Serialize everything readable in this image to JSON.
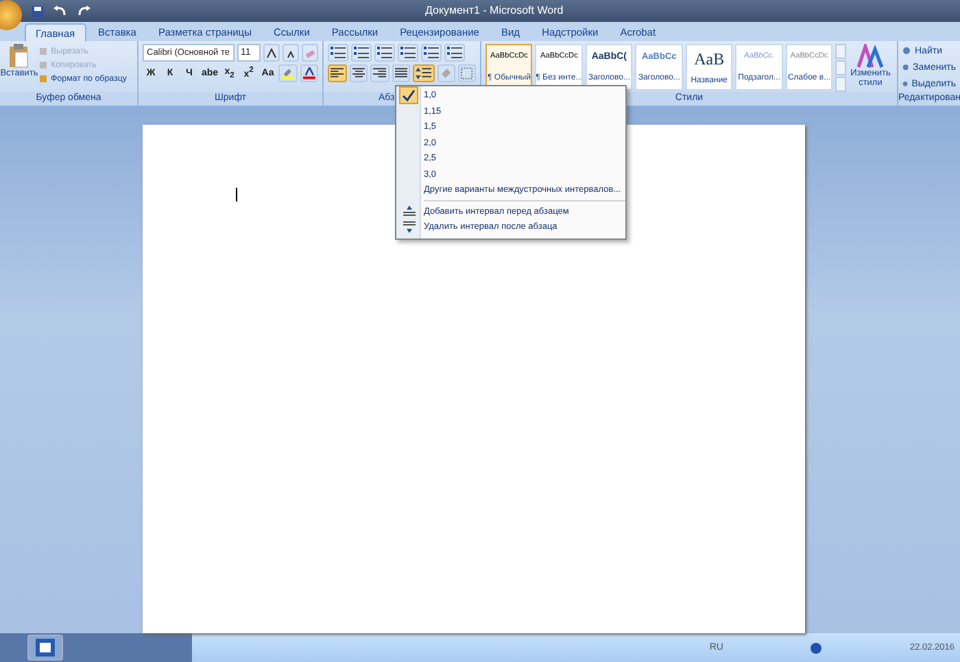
{
  "window": {
    "title": "Документ1 - Microsoft Word"
  },
  "tabs": [
    {
      "label": "Главная",
      "selected": true
    },
    {
      "label": "Вставка",
      "selected": false
    },
    {
      "label": "Разметка страницы",
      "selected": false
    },
    {
      "label": "Ссылки",
      "selected": false
    },
    {
      "label": "Рассылки",
      "selected": false
    },
    {
      "label": "Рецензирование",
      "selected": false
    },
    {
      "label": "Вид",
      "selected": false
    },
    {
      "label": "Надстройки",
      "selected": false
    },
    {
      "label": "Acrobat",
      "selected": false
    }
  ],
  "clipboard": {
    "label": "Буфер обмена",
    "paste": "Вставить",
    "actions": [
      {
        "label": "Вырезать",
        "disabled": true
      },
      {
        "label": "Копировать",
        "disabled": true
      },
      {
        "label": "Формат по образцу",
        "disabled": false
      }
    ]
  },
  "font": {
    "label": "Шрифт",
    "family": "Calibri (Основной те",
    "size": "11",
    "format_buttons": [
      "Ж",
      "К",
      "Ч",
      "abe",
      "x$_{2}$",
      "x$^{2}$",
      "Aa"
    ]
  },
  "paragraph": {
    "label": "Абз"
  },
  "styles": {
    "label": "Стили",
    "items": [
      {
        "preview": "AaBbCcDc",
        "name": "¶ Обычный",
        "kind": "normal",
        "selected": true
      },
      {
        "preview": "AaBbCcDc",
        "name": "¶ Без инте...",
        "kind": "normal",
        "selected": false
      },
      {
        "preview": "AaBbC(",
        "name": "Заголово...",
        "kind": "heading1",
        "selected": false
      },
      {
        "preview": "AaBbCc",
        "name": "Заголово...",
        "kind": "heading2",
        "selected": false
      },
      {
        "preview": "AaB",
        "name": "Название",
        "kind": "title",
        "selected": false
      },
      {
        "preview": "AaBbCc.",
        "name": "Подзагол...",
        "kind": "subtitle",
        "selected": false
      },
      {
        "preview": "AaBbCcDc",
        "name": "Слабое в...",
        "kind": "emphasis",
        "selected": false
      }
    ],
    "change": "Изменить стили"
  },
  "editing": {
    "label": "Редактирован",
    "actions": [
      "Найти",
      "Заменить",
      "Выделить"
    ]
  },
  "spacing_menu": {
    "items": [
      {
        "kind": "spacing",
        "label": "1,0",
        "selected": true
      },
      {
        "kind": "spacing",
        "label": "1,15",
        "selected": false
      },
      {
        "kind": "spacing",
        "label": "1,5",
        "selected": false
      },
      {
        "kind": "spacing",
        "label": "2,0",
        "selected": false
      },
      {
        "kind": "spacing",
        "label": "2,5",
        "selected": false
      },
      {
        "kind": "spacing",
        "label": "3,0",
        "selected": false
      },
      {
        "kind": "option",
        "label": "Другие варианты междустрочных интервалов..."
      },
      {
        "kind": "add",
        "label": "Добавить интервал перед абзацем"
      },
      {
        "kind": "remove",
        "label": "Удалить интервал после абзаца"
      }
    ]
  },
  "taskbar": {
    "language": "RU",
    "date": "22.02.2016"
  }
}
